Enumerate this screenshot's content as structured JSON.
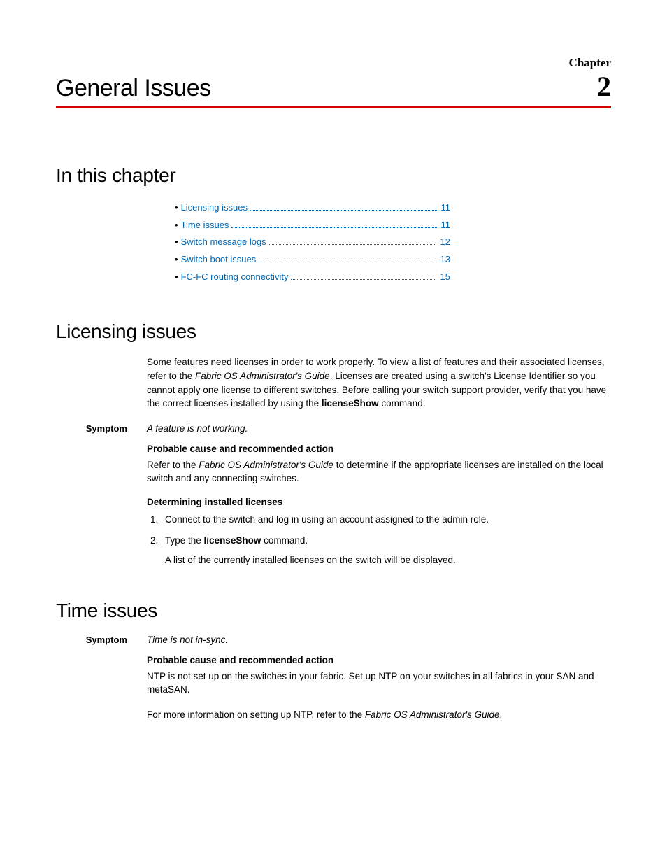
{
  "header": {
    "chapter_label": "Chapter",
    "chapter_title": "General Issues",
    "chapter_number": "2"
  },
  "toc_heading": "In this chapter",
  "toc": [
    {
      "label": "Licensing issues",
      "page": "11"
    },
    {
      "label": "Time issues",
      "page": "11"
    },
    {
      "label": "Switch message logs",
      "page": "12"
    },
    {
      "label": "Switch boot issues",
      "page": "13"
    },
    {
      "label": "FC-FC routing connectivity",
      "page": "15"
    }
  ],
  "licensing": {
    "heading": "Licensing issues",
    "intro_a": "Some features need licenses in order to work properly. To view a list of features and their associated licenses, refer to the ",
    "intro_guide": "Fabric OS Administrator's Guide",
    "intro_b": ". Licenses are created using a switch's License Identifier so you cannot apply one license to different switches. Before calling your switch support provider, verify that you have the correct licenses installed by using the ",
    "intro_cmd": "licenseShow",
    "intro_c": " command.",
    "symptom_label": "Symptom",
    "symptom_text": "A feature is not working.",
    "cause_heading": "Probable cause and recommended action",
    "cause_a": "Refer to the ",
    "cause_guide": "Fabric OS Administrator's Guide",
    "cause_b": " to determine if the appropriate licenses are installed on the local switch and any connecting switches.",
    "det_heading": "Determining installed licenses",
    "step1": "Connect to the switch and log in using an account assigned to the admin role.",
    "step2_a": "Type the ",
    "step2_cmd": "licenseShow",
    "step2_b": " command.",
    "step2_sub": "A list of the currently installed licenses on the switch will be displayed."
  },
  "time": {
    "heading": "Time issues",
    "symptom_label": "Symptom",
    "symptom_text": "Time is not in-sync.",
    "cause_heading": "Probable cause and recommended action",
    "cause_text": "NTP is not set up on the switches in your fabric. Set up NTP on your switches in all fabrics in your SAN and metaSAN.",
    "more_a": "For more information on setting up NTP, refer to the ",
    "more_guide": "Fabric OS Administrator's Guide",
    "more_b": "."
  }
}
